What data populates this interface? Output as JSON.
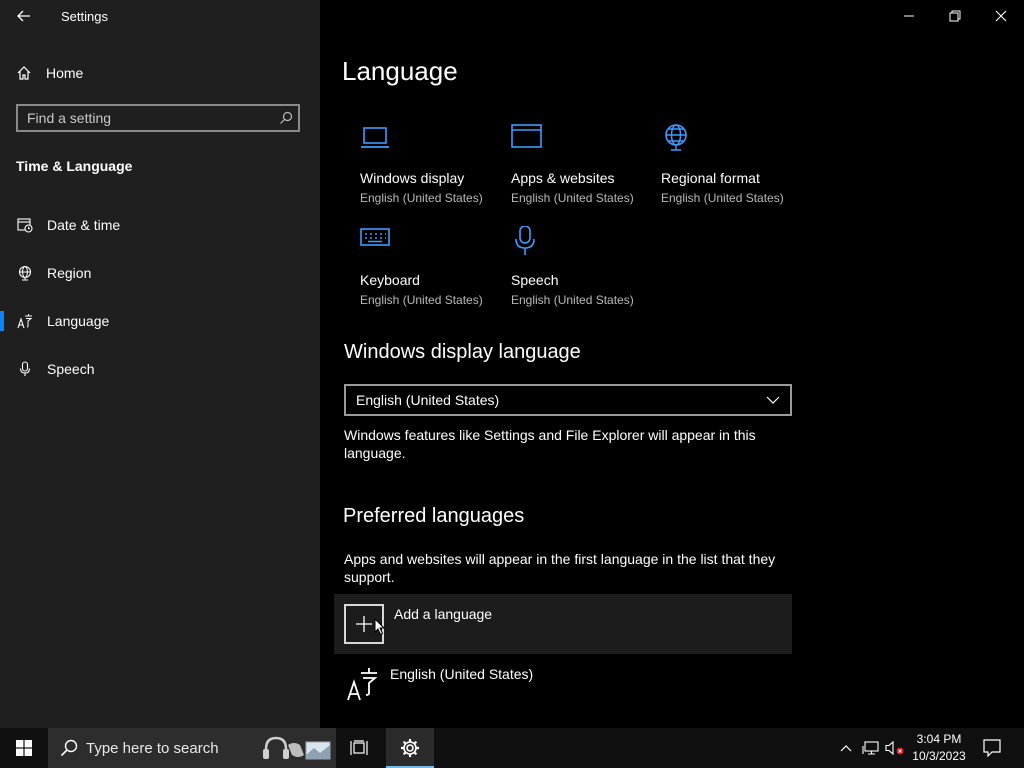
{
  "window": {
    "title": "Settings",
    "controls": {
      "minimize": "minimize-icon",
      "restore": "restore-icon",
      "close": "close-icon"
    }
  },
  "sidebar": {
    "home_label": "Home",
    "search_placeholder": "Find a setting",
    "section_title": "Time & Language",
    "items": [
      {
        "label": "Date & time",
        "icon": "calendar-clock-icon",
        "selected": false
      },
      {
        "label": "Region",
        "icon": "globe-icon",
        "selected": false
      },
      {
        "label": "Language",
        "icon": "language-icon",
        "selected": true
      },
      {
        "label": "Speech",
        "icon": "microphone-icon",
        "selected": false
      }
    ]
  },
  "main": {
    "title": "Language",
    "tiles": [
      {
        "name": "Windows display",
        "sub": "English (United States)",
        "icon": "laptop-icon"
      },
      {
        "name": "Apps & websites",
        "sub": "English (United States)",
        "icon": "browser-window-icon"
      },
      {
        "name": "Regional format",
        "sub": "English (United States)",
        "icon": "globe-icon"
      },
      {
        "name": "Keyboard",
        "sub": "English (United States)",
        "icon": "keyboard-icon"
      },
      {
        "name": "Speech",
        "sub": "English (United States)",
        "icon": "microphone-icon"
      }
    ],
    "display_language": {
      "heading": "Windows display language",
      "selected": "English (United States)",
      "description": "Windows features like Settings and File Explorer will appear in this language."
    },
    "preferred": {
      "heading": "Preferred languages",
      "description": "Apps and websites will appear in the first language in the list that they support.",
      "add_label": "Add a language",
      "languages": [
        {
          "name": "English (United States)"
        }
      ]
    }
  },
  "taskbar": {
    "search_placeholder": "Type here to search",
    "time": "3:04 PM",
    "date": "10/3/2023"
  },
  "colors": {
    "accent": "#0a84ff",
    "icon_blue": "#3f9bff",
    "sidebar_bg": "#1f1f1f"
  }
}
